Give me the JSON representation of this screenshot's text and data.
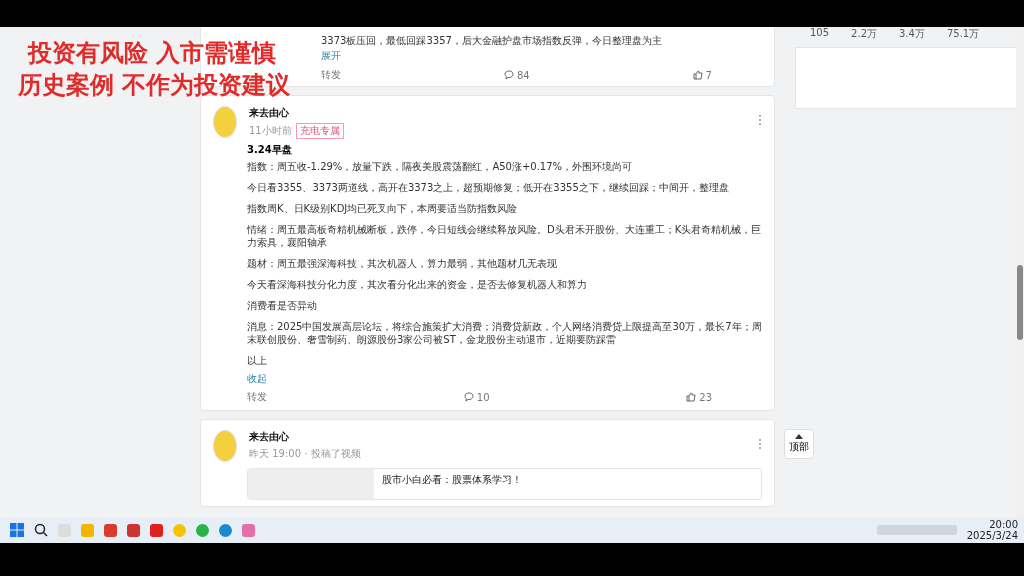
{
  "overlay_notice": [
    "投资有风险 入市需谨慎",
    "历史案例 不作为投资建议"
  ],
  "side_stats": [
    "105",
    "2.2万",
    "3.4万",
    "75.1万"
  ],
  "previous_post": {
    "text": "3373板压回，最低回踩3357，后大金融护盘市场指数反弹，今日整理盘为主",
    "expand": "展开",
    "forward": "转发",
    "comments": "84",
    "likes": "7"
  },
  "post": {
    "author": "来去由心",
    "time": "11小时前",
    "tag": "充电专属",
    "title": "3.24早盘",
    "paragraphs": [
      "指数：周五收-1.29%，放量下跌，隔夜美股震荡翻红，A50涨+0.17%，外围环境尚可",
      "今日看3355、3373两道线，高开在3373之上，超预期修复；低开在3355之下，继续回踩；中间开，整理盘",
      "指数周K、日K级别KDJ均已死叉向下，本周要适当防指数风险",
      "情绪：周五最高板奇精机械断板，跌停，今日短线会继续释放风险。D头君禾开股份、大连重工；K头君奇精机械，巨力索具，襄阳轴承",
      "题材：周五最强深海科技，其次机器人，算力最弱，其他题材几无表现",
      "今天看深海科技分化力度，其次看分化出来的资金，是否去修复机器人和算力",
      "消费看是否异动",
      "消息：2025中国发展高层论坛，将综合施策扩大消费；消费贷新政，个人网络消费贷上限提高至30万，最长7年；周末联创股份、奢雪制药、朗源股份3家公司被ST，金龙股份主动退市，近期要防踩雷",
      "以上"
    ],
    "collapse": "收起",
    "forward": "转发",
    "comments": "10",
    "likes": "23"
  },
  "next_post": {
    "author": "来去由心",
    "time": "昨天 19:00 · 投稿了视频",
    "video_title": "股市小白必看：股票体系学习！"
  },
  "back_to_top": "顶部",
  "taskbar": {
    "time": "20:00",
    "date": "2025/3/24"
  }
}
